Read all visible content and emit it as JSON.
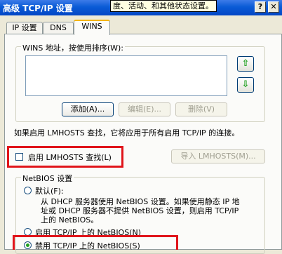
{
  "window": {
    "title": "高级 TCP/IP 设置",
    "help_label": "?",
    "close_label": "✕"
  },
  "tooltip": {
    "text": "度、活动、和其他状态设置。"
  },
  "tabs": [
    {
      "label": "IP 设置"
    },
    {
      "label": "DNS"
    },
    {
      "label": "WINS"
    }
  ],
  "wins": {
    "group_label": "WINS 地址，按使用排序(W):",
    "up_arrow": "⇧",
    "down_arrow": "⇩",
    "add_label": "添加(A)...",
    "edit_label": "编辑(E)...",
    "delete_label": "删除(V)"
  },
  "lmhosts": {
    "info": "如果启用 LMHOSTS 查找，它将应用于所有启用 TCP/IP 的连接。",
    "enable_label": "启用 LMHOSTS 查找(L)",
    "enable_checked": false,
    "import_label": "导入 LMHOSTS(M)..."
  },
  "netbios": {
    "group_label": "NetBIOS 设置",
    "default_label": "默认(F):",
    "default_desc": [
      "从 DHCP 服务器使用 NetBIOS 设置。如果使用静态 IP 地",
      "址或 DHCP 服务器不提供 NetBIOS 设置，则启用 TCP/IP",
      "上的 NetBIOS。"
    ],
    "enable_label": "启用 TCP/IP 上的 NetBIOS(N)",
    "disable_label": "禁用 TCP/IP 上的 NetBIOS(S)",
    "selected": "disable"
  },
  "colors": {
    "titlebar": "#0a5bd6",
    "highlight": "#e0151b",
    "face": "#ece9d8"
  }
}
